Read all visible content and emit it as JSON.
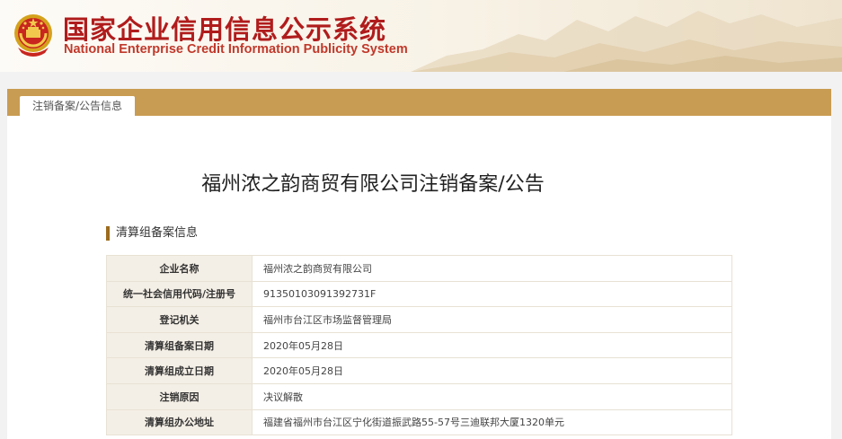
{
  "header": {
    "title": "国家企业信用信息公示系统",
    "subtitle": "National Enterprise Credit Information Publicity System",
    "emblem_icon": "national-emblem-icon",
    "accent_color": "#b01c1c"
  },
  "tabs": [
    {
      "label": "注销备案/公告信息",
      "active": true
    }
  ],
  "page_title": "福州浓之韵商贸有限公司注销备案/公告",
  "section": {
    "title": "清算组备案信息"
  },
  "rows": [
    {
      "label": "企业名称",
      "value": "福州浓之韵商贸有限公司"
    },
    {
      "label": "统一社会信用代码/注册号",
      "value": "91350103091392731F"
    },
    {
      "label": "登记机关",
      "value": "福州市台江区市场监督管理局"
    },
    {
      "label": "清算组备案日期",
      "value": "2020年05月28日"
    },
    {
      "label": "清算组成立日期",
      "value": "2020年05月28日"
    },
    {
      "label": "注销原因",
      "value": "决议解散"
    },
    {
      "label": "清算组办公地址",
      "value": "福建省福州市台江区宁化街道振武路55-57号三迪联邦大厦1320单元"
    }
  ],
  "colors": {
    "tab_bar": "#c89c52",
    "section_marker": "#9c6b1e",
    "label_cell": "#f4efe6"
  }
}
